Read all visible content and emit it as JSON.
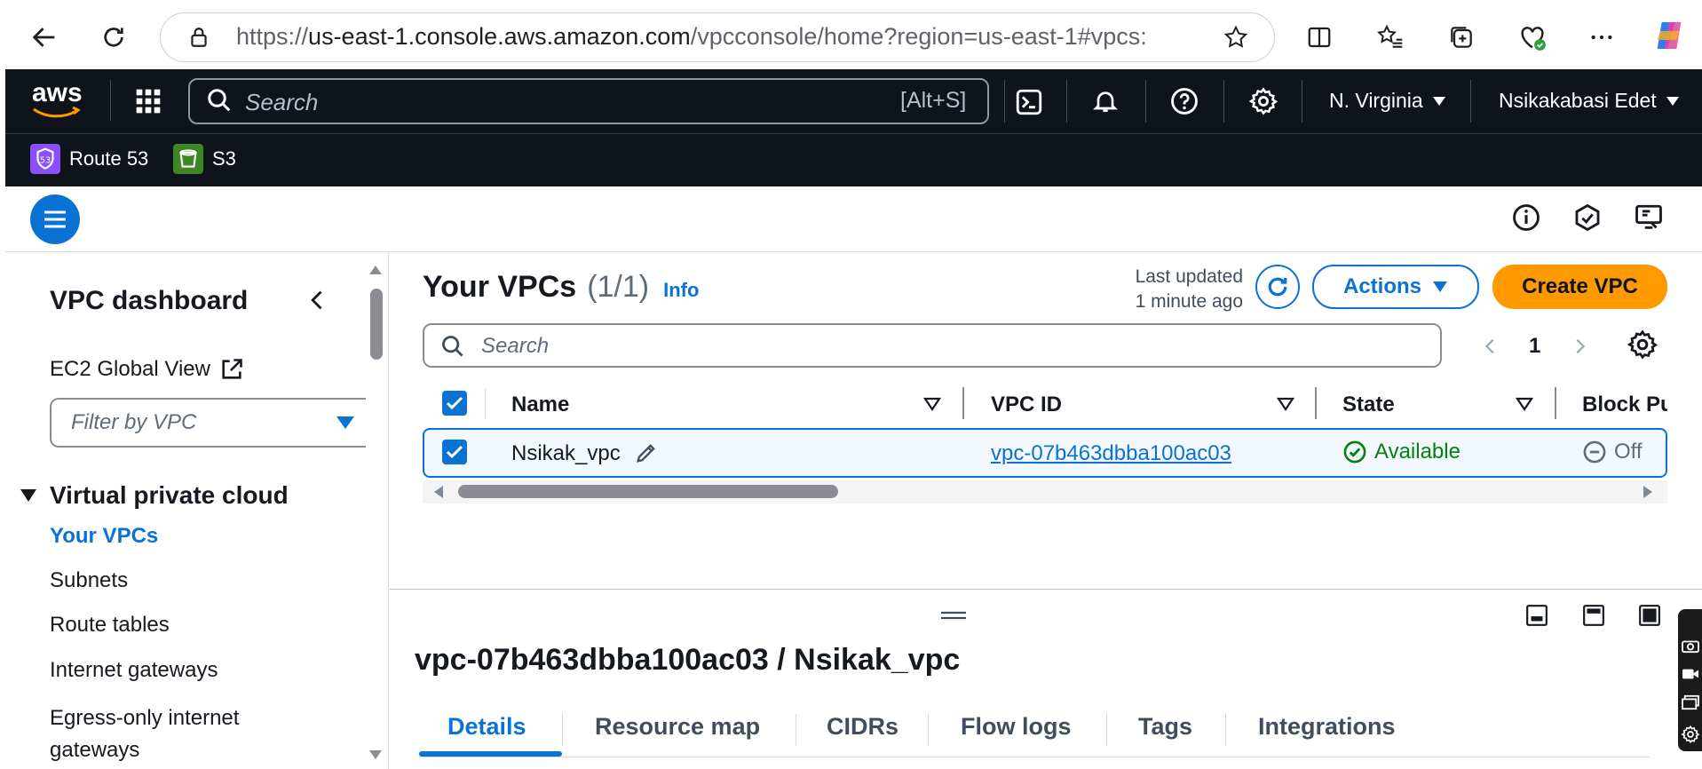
{
  "browser": {
    "url_prefix": "https://",
    "url_domain": "us-east-1.console.aws.amazon.com",
    "url_path": "/vpcconsole/home?region=us-east-1#vpcs:"
  },
  "nav": {
    "logo": "aws",
    "search_placeholder": "Search",
    "search_shortcut": "[Alt+S]",
    "region": "N. Virginia",
    "user": "Nsikakabasi Edet"
  },
  "favorites": [
    {
      "label": "Route 53",
      "icon": "route53-icon",
      "color": "#8c4fff"
    },
    {
      "label": "S3",
      "icon": "s3-icon",
      "color": "#3f8624"
    }
  ],
  "sidebar": {
    "title": "VPC dashboard",
    "ec2_global_view": "EC2 Global View",
    "filter_placeholder": "Filter by VPC",
    "section": "Virtual private cloud",
    "items": [
      "Your VPCs",
      "Subnets",
      "Route tables",
      "Internet gateways",
      "Egress-only internet gateways"
    ]
  },
  "main": {
    "title": "Your VPCs",
    "count": "(1/1)",
    "info": "Info",
    "last_updated_line1": "Last updated",
    "last_updated_line2": "1 minute ago",
    "actions_label": "Actions",
    "create_label": "Create VPC",
    "search_placeholder": "Search",
    "page": "1",
    "columns": [
      "Name",
      "VPC ID",
      "State",
      "Block Pu"
    ],
    "rows": [
      {
        "name": "Nsikak_vpc",
        "vpc_id": "vpc-07b463dbba100ac03",
        "state": "Available",
        "block": "Off"
      }
    ]
  },
  "details": {
    "heading": "vpc-07b463dbba100ac03 / Nsikak_vpc",
    "tabs": [
      "Details",
      "Resource map",
      "CIDRs",
      "Flow logs",
      "Tags",
      "Integrations"
    ]
  },
  "colors": {
    "accent": "#0972d3",
    "primary": "#ff9900",
    "success": "#037f0c",
    "nav_bg": "#0f141a"
  }
}
